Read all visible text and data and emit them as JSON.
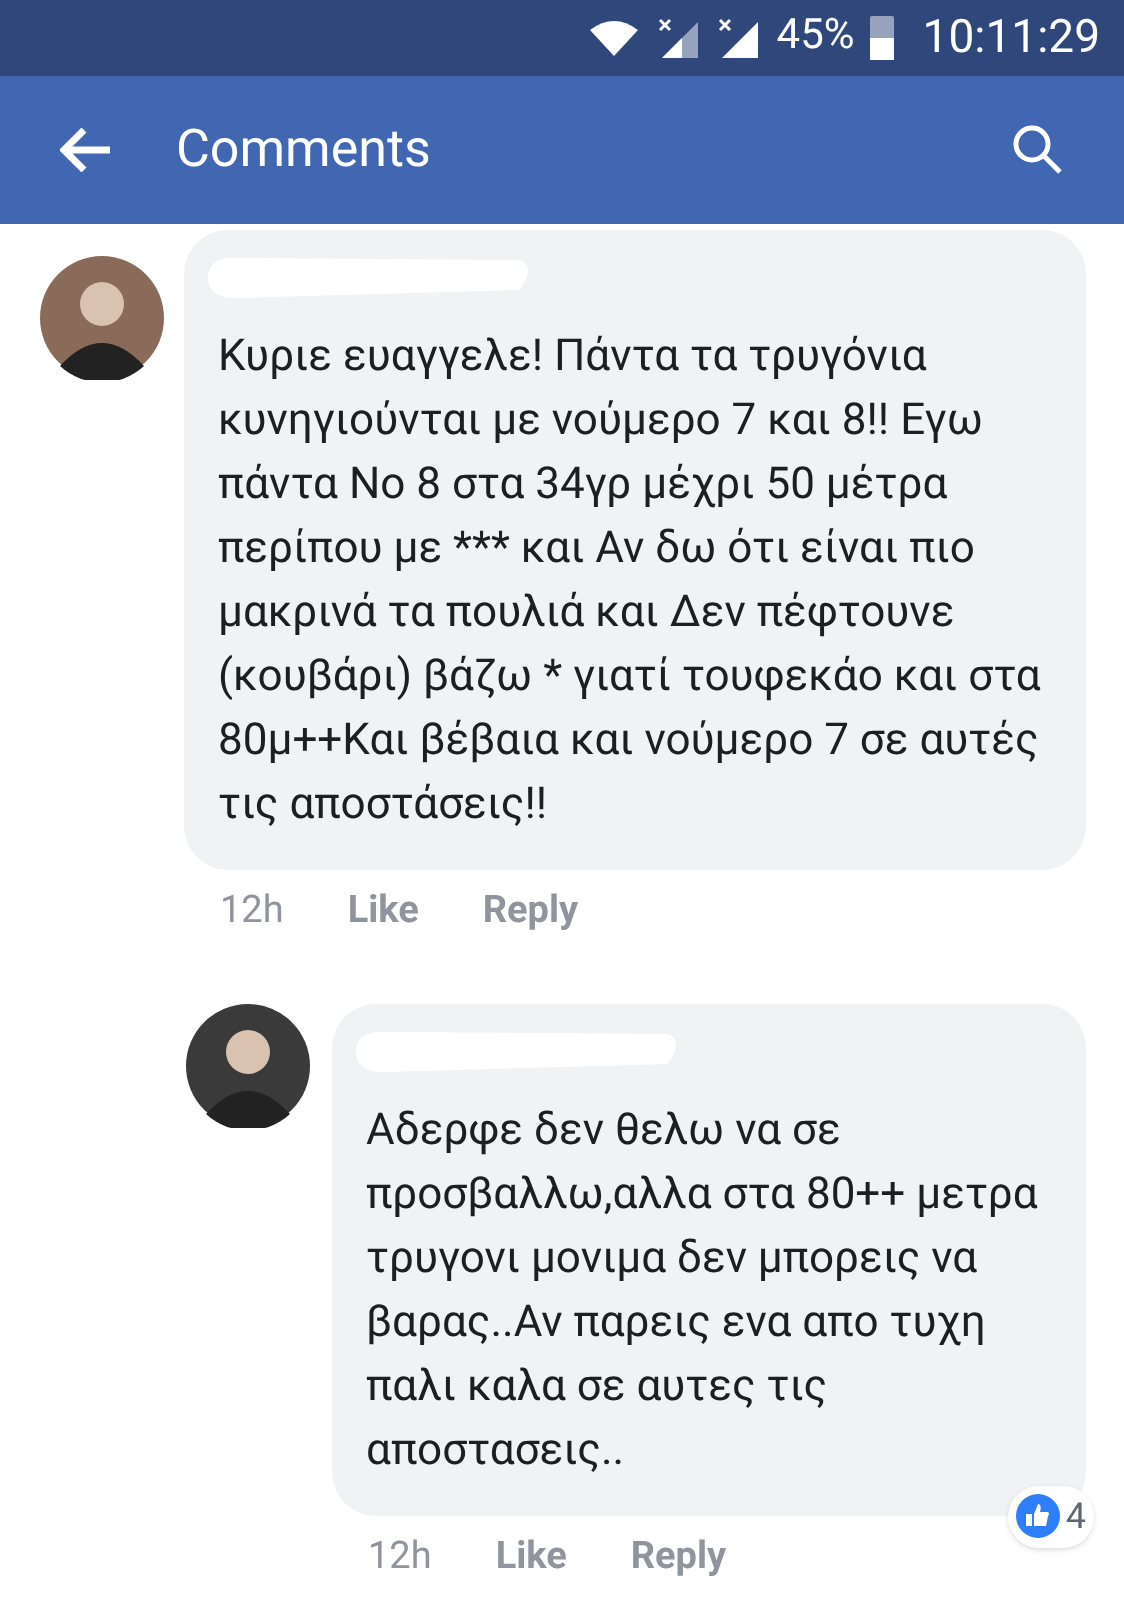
{
  "status_bar": {
    "battery": "45%",
    "time": "10:11:29"
  },
  "header": {
    "title": "Comments"
  },
  "comments": [
    {
      "text": "Κυριε ευαγγελε! Πάντα τα τρυγόνια κυνηγιούνται με νούμερο 7 και 8!! Εγω πάντα Νο 8 στα 34γρ μέχρι 50 μέτρα περίπου με *** και Αν δω ότι είναι πιο μακρινά τα πουλιά και Δεν πέφτουνε (κουβάρι) βάζω  * γιατί τουφεκάο και στα 80μ++Και βέβαια και νούμερο 7 σε αυτές τις αποστάσεις!!",
      "time": "12h",
      "like": "Like",
      "reply": "Reply",
      "children": [
        {
          "text": "Αδερφε δεν θελω να σε προσβαλλω,αλλα στα 80++ μετρα τρυγονι μονιμα δεν μπορεις να βαρας..Αν παρεις ενα απο τυχη παλι καλα σε αυτες τις αποστασεις..",
          "time": "12h",
          "like": "Like",
          "reply": "Reply",
          "reactions": "4"
        }
      ]
    }
  ]
}
